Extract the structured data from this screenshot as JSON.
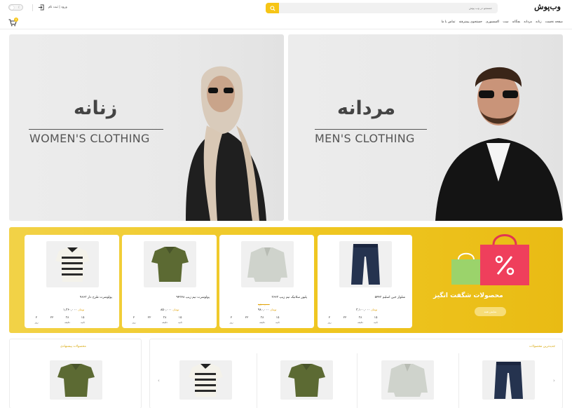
{
  "header": {
    "logo": "وب‌پوش",
    "search_placeholder": "جستجو در وب پوش",
    "login_label": "ورود | ثبت نام",
    "cart_count": "0",
    "nav": [
      "صفحه نخست",
      "زنانه",
      "مردانه",
      "بچگانه",
      "ست",
      "اکسسوری",
      "جستجوی پیشرفته",
      "تماس با ما"
    ]
  },
  "banners": {
    "women": {
      "title": "زنانه",
      "subtitle": "WOMEN'S CLOTHING"
    },
    "men": {
      "title": "مردانه",
      "subtitle": "MEN'S CLOTHING"
    }
  },
  "amazing": {
    "title": "محصولات شگفت انگیز",
    "button": "نمایش همه",
    "timer_labels": [
      "ثانیه",
      "دقیقه",
      "ساعت",
      "روز"
    ],
    "products": [
      {
        "name": "شلوار جین اسلیم ۵۴۴۳",
        "old_price": "",
        "price": "۳,۱۰۰,۰۰۰",
        "currency": "تومان",
        "timer": [
          "۱۵",
          "۳۸",
          "۲۲",
          "۲"
        ]
      },
      {
        "name": "پلیور سلانیک نیم زیپ ۳۶۲۳",
        "old_price": "۱,۲۰۰,۰۰۰",
        "price": "۹۸۰,۰۰۰",
        "currency": "تومان",
        "timer": [
          "۱۵",
          "۳۸",
          "۲۲",
          "۲"
        ]
      },
      {
        "name": "پولوشرت نیم زیپ ۹۴۳۲۸",
        "old_price": "",
        "price": "۸۵۰,۰۰۰",
        "currency": "تومان",
        "timer": [
          "۱۵",
          "۳۸",
          "۲۲",
          "۲"
        ]
      },
      {
        "name": "پولوشرت طرح دار ۹۶۶۳",
        "old_price": "",
        "price": "۱,۳۶۰,۰۰۰",
        "currency": "تومان",
        "timer": [
          "۱۵",
          "۳۸",
          "۲۲",
          "۲"
        ]
      }
    ]
  },
  "sections": {
    "suggested_title": "محصولات پیشنهادی",
    "newest_title": "جدیدترین محصولات"
  },
  "colors": {
    "accent": "#f6c516",
    "banner_bg": "#e9e9e9",
    "amazing_bg": "#f0c823"
  }
}
